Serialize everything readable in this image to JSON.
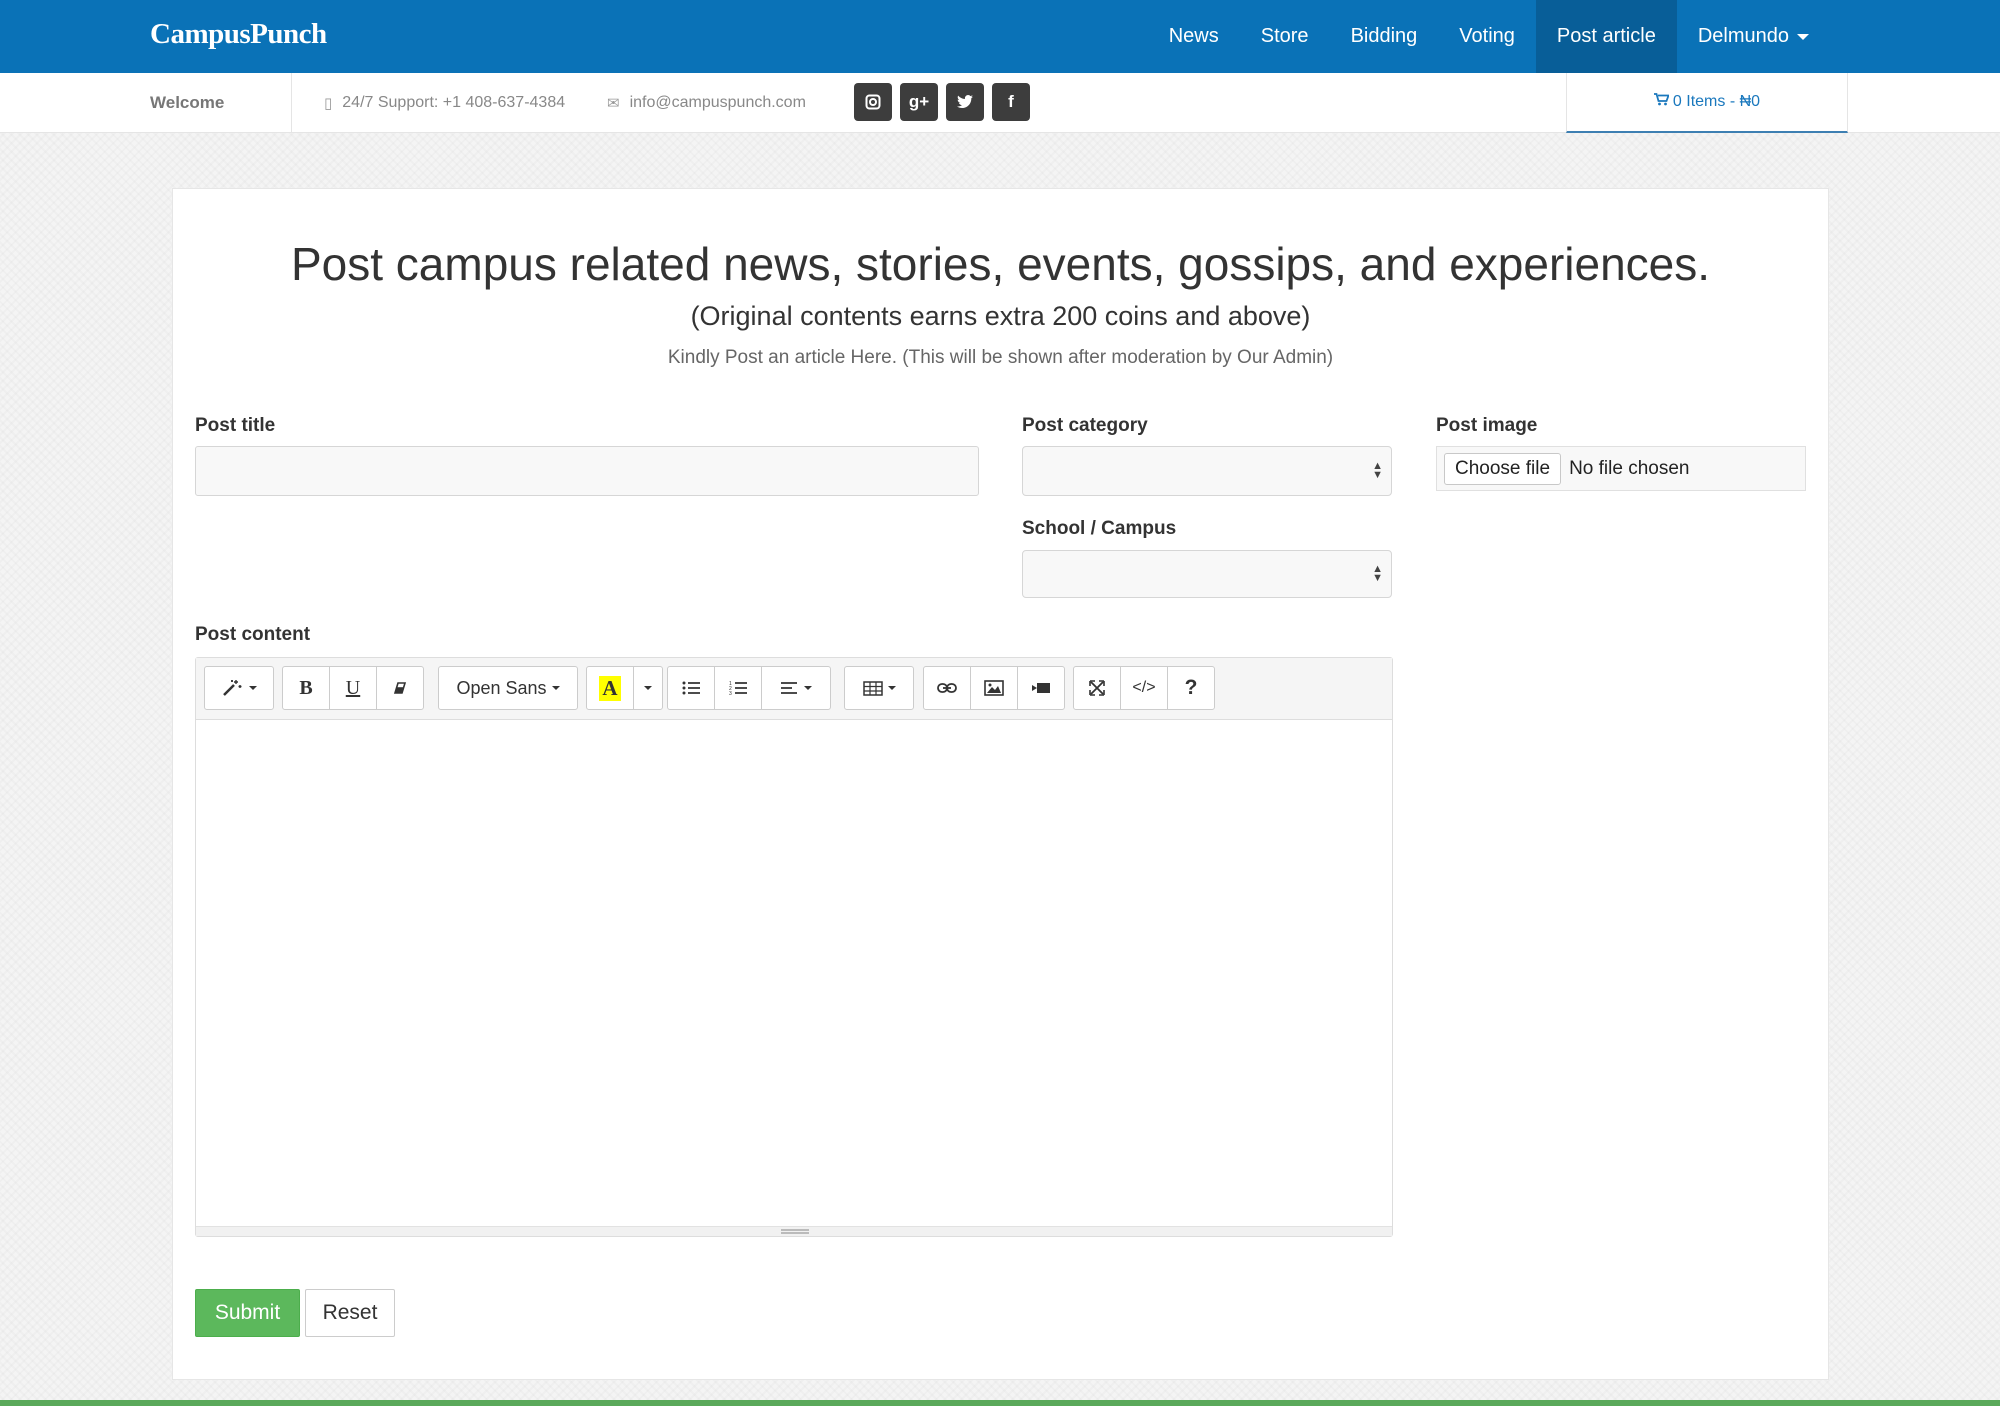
{
  "brand": "CampusPunch",
  "nav": {
    "items": [
      "News",
      "Store",
      "Bidding",
      "Voting",
      "Post article"
    ],
    "active": "Post article",
    "user": "Delmundo"
  },
  "infobar": {
    "welcome": "Welcome",
    "support": "24/7 Support: +1 408-637-4384",
    "email": "info@campuspunch.com",
    "social_icons": [
      "instagram-icon",
      "google-plus-icon",
      "twitter-icon",
      "facebook-icon"
    ],
    "cart": "0 Items - ₦0"
  },
  "form": {
    "heading": "Post campus related news, stories, events, gossips, and experiences.",
    "subheading": "(Original contents earns extra 200 coins and above)",
    "note": "Kindly Post an article Here. (This will be shown after moderation by Our Admin)",
    "post_title_label": "Post title",
    "post_title_value": "",
    "post_category_label": "Post category",
    "post_category_value": "",
    "school_label": "School / Campus",
    "school_value": "",
    "post_image_label": "Post image",
    "choose_file": "Choose file",
    "file_status": "No file chosen",
    "post_content_label": "Post content",
    "submit": "Submit",
    "reset": "Reset"
  },
  "editor": {
    "font_name": "Open Sans",
    "toolbar_icons": [
      "magic-icon",
      "bold-icon",
      "underline-icon",
      "eraser-icon",
      "font-family-dropdown",
      "text-color-icon",
      "color-dropdown-icon",
      "unordered-list-icon",
      "ordered-list-icon",
      "align-icon",
      "table-icon",
      "link-icon",
      "image-icon",
      "video-icon",
      "fullscreen-icon",
      "code-view-icon",
      "help-icon"
    ],
    "highlight_color": "#ffff00"
  },
  "colors": {
    "navbar": "#0a72b7",
    "navbar_active": "#085e98",
    "submit": "#5cb85c"
  }
}
